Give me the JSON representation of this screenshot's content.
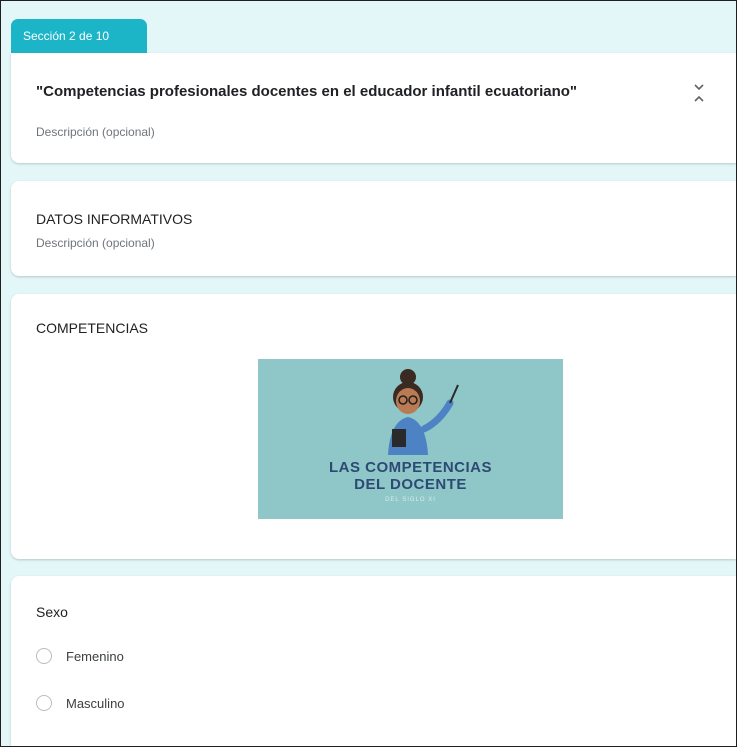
{
  "section_tab": {
    "label": "Sección 2 de 10"
  },
  "sections": [
    {
      "title": "\"Competencias profesionales docentes en el educador infantil ecuatoriano\"",
      "description": "Descripción (opcional)"
    },
    {
      "title": "DATOS INFORMATIVOS",
      "description": "Descripción (opcional)"
    },
    {
      "title": "COMPETENCIAS",
      "image": {
        "line1": "LAS COMPETENCIAS",
        "line2": "DEL DOCENTE",
        "line3": "DEL SIGLO XI"
      }
    },
    {
      "question": "Sexo",
      "options": [
        "Femenino",
        "Masculino"
      ]
    }
  ],
  "icons": {
    "collapse": "collapse-section-icon"
  },
  "colors": {
    "accent": "#1cb5c7",
    "background": "#e3f6f8",
    "image_bg": "#8fc6c8",
    "image_text": "#2d4a74"
  }
}
